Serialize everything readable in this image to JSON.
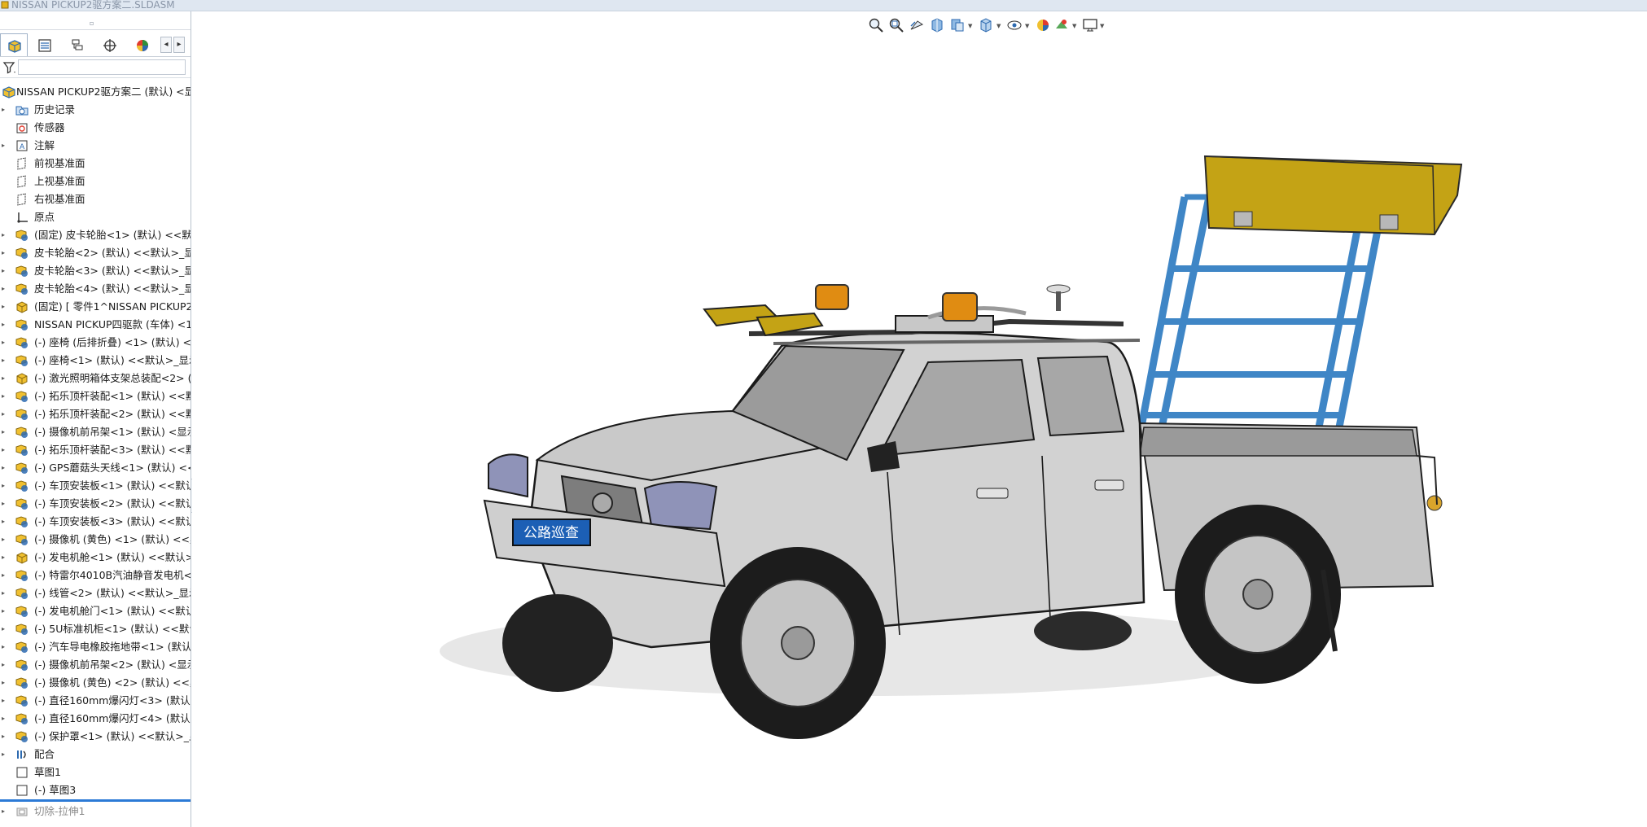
{
  "window": {
    "title": "NISSAN PICKUP2驱方案二.SLDASM"
  },
  "feature_tree": {
    "root": "NISSAN PICKUP2驱方案二 (默认) <显示",
    "items": [
      {
        "label": "历史记录",
        "icon": "history-folder-icon",
        "expand": true
      },
      {
        "label": "传感器",
        "icon": "sensor-icon",
        "expand": false
      },
      {
        "label": "注解",
        "icon": "annotation-icon",
        "expand": true
      },
      {
        "label": "前视基准面",
        "icon": "plane-icon",
        "expand": false
      },
      {
        "label": "上视基准面",
        "icon": "plane-icon",
        "expand": false
      },
      {
        "label": "右视基准面",
        "icon": "plane-icon",
        "expand": false
      },
      {
        "label": "原点",
        "icon": "origin-icon",
        "expand": false
      },
      {
        "label": "(固定) 皮卡轮胎<1> (默认) <<默认",
        "icon": "subassembly-icon",
        "expand": true
      },
      {
        "label": "皮卡轮胎<2> (默认) <<默认>_显示",
        "icon": "subassembly-icon",
        "expand": true
      },
      {
        "label": "皮卡轮胎<3> (默认) <<默认>_显示",
        "icon": "subassembly-icon",
        "expand": true
      },
      {
        "label": "皮卡轮胎<4> (默认) <<默认>_显示",
        "icon": "subassembly-icon",
        "expand": true
      },
      {
        "label": "(固定) [ 零件1^NISSAN PICKUP2驱",
        "icon": "part-icon",
        "expand": true
      },
      {
        "label": "NISSAN PICKUP四驱款 (车体) <1",
        "icon": "subassembly-icon",
        "expand": true
      },
      {
        "label": "(-) 座椅 (后排折叠) <1> (默认) <",
        "icon": "subassembly-icon",
        "expand": true
      },
      {
        "label": "(-) 座椅<1> (默认) <<默认>_显示",
        "icon": "subassembly-icon",
        "expand": true
      },
      {
        "label": "(-) 激光照明箱体支架总装配<2> (默",
        "icon": "part-icon",
        "expand": true
      },
      {
        "label": "(-) 拓乐顶杆装配<1> (默认) <<默认",
        "icon": "subassembly-icon",
        "expand": true
      },
      {
        "label": "(-) 拓乐顶杆装配<2> (默认) <<默认",
        "icon": "subassembly-icon",
        "expand": true
      },
      {
        "label": "(-) 摄像机前吊架<1> (默认) <显示",
        "icon": "subassembly-icon",
        "expand": true
      },
      {
        "label": "(-) 拓乐顶杆装配<3> (默认) <<默认",
        "icon": "subassembly-icon",
        "expand": true
      },
      {
        "label": "(-) GPS蘑菇头天线<1> (默认) <<默",
        "icon": "subassembly-icon",
        "expand": true
      },
      {
        "label": "(-) 车顶安装板<1> (默认) <<默认>_",
        "icon": "subassembly-icon",
        "expand": true
      },
      {
        "label": "(-) 车顶安装板<2> (默认) <<默认>_",
        "icon": "subassembly-icon",
        "expand": true
      },
      {
        "label": "(-) 车顶安装板<3> (默认) <<默认>_",
        "icon": "subassembly-icon",
        "expand": true
      },
      {
        "label": "(-) 摄像机 (黄色) <1> (默认) <<默",
        "icon": "subassembly-icon",
        "expand": true
      },
      {
        "label": "(-) 发电机舱<1> (默认) <<默认>_显",
        "icon": "part-icon",
        "expand": true
      },
      {
        "label": "(-) 特雷尔4010B汽油静音发电机<1",
        "icon": "subassembly-icon",
        "expand": true
      },
      {
        "label": "(-) 线管<2> (默认) <<默认>_显示状",
        "icon": "subassembly-icon",
        "expand": true
      },
      {
        "label": "(-) 发电机舱门<1> (默认) <<默认>_",
        "icon": "subassembly-icon",
        "expand": true
      },
      {
        "label": "(-) 5U标准机柜<1> (默认) <<默认>_",
        "icon": "subassembly-icon",
        "expand": true
      },
      {
        "label": "(-) 汽车导电橡胶拖地带<1> (默认)",
        "icon": "subassembly-icon",
        "expand": true
      },
      {
        "label": "(-) 摄像机前吊架<2> (默认) <显示",
        "icon": "subassembly-icon",
        "expand": true
      },
      {
        "label": "(-) 摄像机 (黄色) <2> (默认) <<默",
        "icon": "subassembly-icon",
        "expand": true
      },
      {
        "label": "(-) 直径160mm爆闪灯<3> (默认) <",
        "icon": "subassembly-icon",
        "expand": true
      },
      {
        "label": "(-) 直径160mm爆闪灯<4> (默认) <",
        "icon": "subassembly-icon",
        "expand": true
      },
      {
        "label": "(-) 保护罩<1> (默认) <<默认>_显示",
        "icon": "subassembly-icon",
        "expand": true
      },
      {
        "label": "配合",
        "icon": "mates-icon",
        "expand": true
      },
      {
        "label": "草图1",
        "icon": "sketch-icon",
        "expand": false
      },
      {
        "label": "(-) 草图3",
        "icon": "sketch-icon",
        "expand": false
      }
    ],
    "suppressed_item": {
      "label": "切除-拉伸1",
      "icon": "cut-extrude-icon"
    }
  },
  "model": {
    "license_plate": "公路巡查"
  },
  "colors": {
    "accent": "#2c7ad6",
    "truck_body": "#d2d2d2",
    "tower": "#3f86c6",
    "light_box": "#c4a315",
    "beacon": "#e08c12"
  }
}
